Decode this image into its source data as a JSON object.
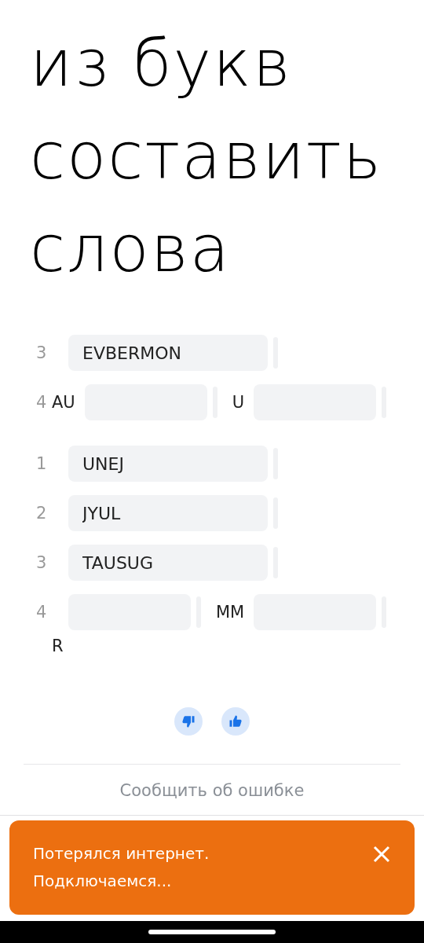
{
  "note": {
    "lines": [
      "из букв",
      "составить",
      "слова"
    ]
  },
  "groups": [
    {
      "rows": [
        {
          "number": "3",
          "parts": [
            {
              "kind": "wide_field",
              "value": "EVBERMON"
            }
          ]
        },
        {
          "number": "4",
          "parts": [
            {
              "kind": "text",
              "text": "AU"
            },
            {
              "kind": "field"
            },
            {
              "kind": "text",
              "text": "U"
            },
            {
              "kind": "field"
            }
          ]
        }
      ]
    },
    {
      "rows": [
        {
          "number": "1",
          "parts": [
            {
              "kind": "wide_field",
              "value": "UNEJ"
            }
          ]
        },
        {
          "number": "2",
          "parts": [
            {
              "kind": "wide_field",
              "value": "JYUL"
            }
          ]
        },
        {
          "number": "3",
          "parts": [
            {
              "kind": "wide_field",
              "value": "TAUSUG"
            }
          ]
        },
        {
          "number": "4",
          "parts": [
            {
              "kind": "field"
            },
            {
              "kind": "text",
              "text": "MM"
            },
            {
              "kind": "field"
            },
            {
              "kind": "wrapped_text",
              "text": "R"
            }
          ]
        }
      ]
    }
  ],
  "feedback": [
    {
      "kind": "dislike"
    },
    {
      "kind": "like"
    }
  ],
  "report_link": "Сообщить об ошибке",
  "toast": {
    "lines": [
      "Потерялся интернет.",
      "Подключаемся..."
    ]
  }
}
